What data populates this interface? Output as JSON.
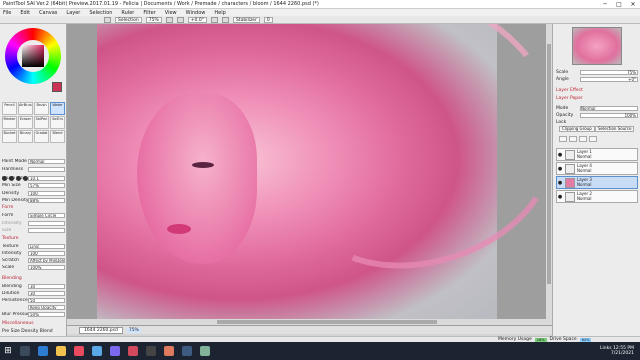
{
  "window": {
    "title": "PaintTool SAI Ver.2 (64bit) Preview.2017.01.19 - Felicia | Documents / Work / Premade / characters / bloom / 1644 2260.psd (*)",
    "controls": [
      "─",
      "□",
      "✕"
    ]
  },
  "menu": [
    "File",
    "Edit",
    "Canvas",
    "Layer",
    "Selection",
    "Ruler",
    "Filter",
    "View",
    "Window",
    "Help"
  ],
  "toolbar": {
    "selection_label": "Selection",
    "zoom": "75%",
    "angle": "+0.0°",
    "stabilizer_label": "Stabilizer",
    "stabilizer_value": "0"
  },
  "tools": [
    "Pencil",
    "AirBrush",
    "Brush",
    "Water",
    "Marker",
    "Eraser",
    "SelPen",
    "SelErs",
    "Bucket",
    "Binary",
    "Gradat",
    "Blend"
  ],
  "brush_props": {
    "paint_mode_label": "Paint Mode",
    "paint_mode_value": "Normal",
    "hardness_label": "Hardness",
    "brush_size_label": "Brush Size",
    "brush_size_value": "10.1",
    "min_size_label": "Min Size",
    "min_size_value": "57%",
    "density_label": "Density",
    "density_value": "100",
    "min_density_label": "Min Density",
    "min_density_value": "88%"
  },
  "form": {
    "section": "Form",
    "form_label": "Form",
    "form_value": "Simple Circle",
    "intensity_label": "Intensity",
    "size_label": "Size"
  },
  "texture": {
    "section": "Texture",
    "texture_label": "Texture",
    "texture_value": "Linic",
    "intensity_label": "Intensity",
    "intensity_value": "100",
    "scratch_label": "Scratch",
    "scratch_value": "Affect by MinDens",
    "scale_label": "Scale",
    "scale_value": "100%"
  },
  "blending": {
    "section": "Blending",
    "blending_label": "Blending",
    "blending_value": "30",
    "dilution_label": "Dilution",
    "dilution_value": "30",
    "persistence_label": "Persistence",
    "persistence_value": "50",
    "keep_opacity": "Keep Opacity",
    "blur_label": "Blur Pressure",
    "blur_value": "50%"
  },
  "misc": {
    "section": "Miscellaneous",
    "bottom_row": "Pre  Size  Density  Blend"
  },
  "document_tab": {
    "name": "1644 2260.psd",
    "zoom": "75%"
  },
  "right_panel": {
    "scale_label": "Scale",
    "scale_value": "75%",
    "angle_label": "Angle",
    "angle_value": "+0°",
    "layer_effect": "Layer Effect",
    "layer_paper": "Layer Paper",
    "mode_label": "Mode",
    "mode_value": "Normal",
    "opacity_label": "Opacity",
    "opacity_value": "100%",
    "lock_label": "Lock",
    "clipping_group": "Clipping Group",
    "selection_source": "Selection Source"
  },
  "layers": [
    {
      "name": "Layer 1",
      "sub": "Normal",
      "selected": false
    },
    {
      "name": "Layer 4",
      "sub": "Normal",
      "selected": false
    },
    {
      "name": "Layer 3",
      "sub": "Normal",
      "selected": true
    },
    {
      "name": "Layer 2",
      "sub": "Normal",
      "selected": false
    }
  ],
  "status": {
    "memory_label": "Memory Usage",
    "memory_value": "16%",
    "drive_label": "Drive Space",
    "drive_value": "64%"
  },
  "taskbar": {
    "time": "12:55 PM",
    "date": "7/21/2021",
    "lang": "Links"
  }
}
